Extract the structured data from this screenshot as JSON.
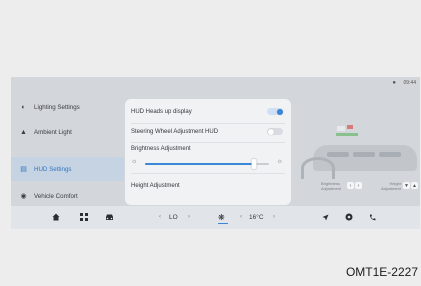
{
  "status": {
    "user_icon": "person-icon",
    "time": "09:44"
  },
  "sidebar": {
    "items": [
      {
        "label": "Lighting Settings",
        "icon": "headlight-icon",
        "active": false
      },
      {
        "label": "Ambient Light",
        "icon": "ambient-light-icon",
        "active": false
      },
      {
        "label": "HUD Settings",
        "icon": "hud-icon",
        "active": true
      },
      {
        "label": "Vehicle Comfort",
        "icon": "car-comfort-icon",
        "active": false
      }
    ]
  },
  "panel": {
    "hud_toggle": {
      "label": "HUD Heads up display",
      "on": true
    },
    "steering_toggle": {
      "label": "Steering Wheel Adjustment HUD",
      "on": false
    },
    "brightness": {
      "label": "Brightness Adjustment",
      "value": 0.88
    },
    "height_label": "Height Adjustment"
  },
  "preview": {
    "brightness_label": "Brightness Adjustment",
    "height_label": "Height Adjustment",
    "left_arrow": "‹",
    "right_arrow": "›",
    "down_arrow": "▼",
    "up_arrow": "▲"
  },
  "bottombar": {
    "fan_level": "LO",
    "temperature": "16°C",
    "prev": "‹",
    "next": "›"
  },
  "image_code": "OMT1E-2227",
  "colors": {
    "accent": "#2f75c2",
    "screen_bg": "#d3d6da",
    "panel_bg": "#f1f2f4"
  }
}
